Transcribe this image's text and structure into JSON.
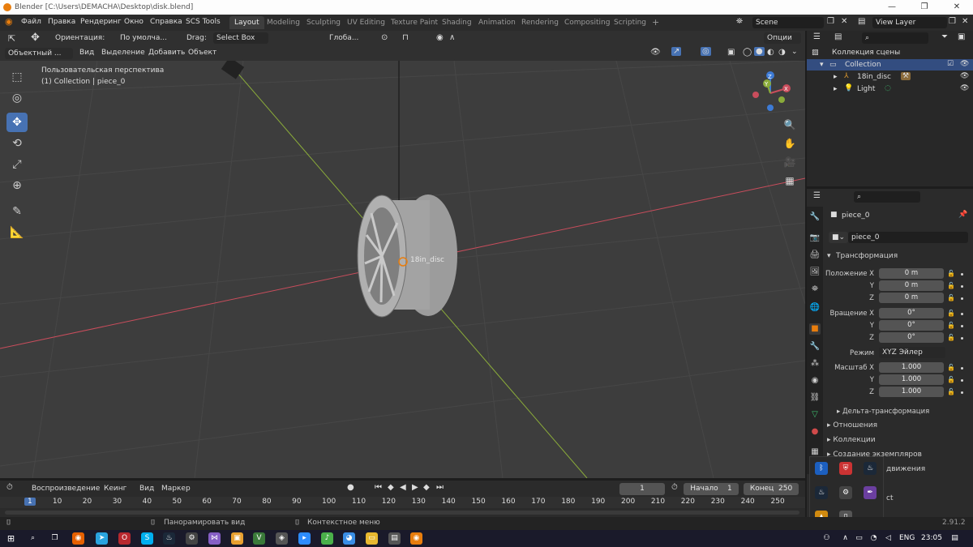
{
  "window": {
    "title": "Blender [C:\\Users\\DEMACHA\\Desktop\\disk.blend]",
    "minimize": "—",
    "maximize": "❐",
    "close": "✕"
  },
  "menu": {
    "items": [
      "Файл",
      "Правка",
      "Рендеринг",
      "Окно",
      "Справка",
      "SCS Tools"
    ]
  },
  "workspaces": {
    "tabs": [
      "Layout",
      "Modeling",
      "Sculpting",
      "UV Editing",
      "Texture Paint",
      "Shading",
      "Animation",
      "Rendering",
      "Compositing",
      "Scripting"
    ],
    "active": "Layout",
    "add": "+"
  },
  "scene": {
    "label": "Scene",
    "view_layer": "View Layer"
  },
  "header": {
    "orientation_label": "Ориентация:",
    "orientation_value": "По умолча...",
    "drag_label": "Drag:",
    "drag_value": "Select Box",
    "global_value": "Глоба...",
    "options": "Опции"
  },
  "viewport_header": {
    "mode": "Объектный ...",
    "view": "Вид",
    "select": "Выделение",
    "add": "Добавить",
    "object": "Объект"
  },
  "viewport": {
    "perspective": "Пользовательская перспектива",
    "collection_info": "(1) Collection | piece_0",
    "object_label": "18in_disc"
  },
  "gizmo": {
    "x": "X",
    "y": "Y",
    "z": "Z"
  },
  "outliner": {
    "root": "Коллекция сцены",
    "collection": "Collection",
    "items": [
      {
        "name": "18in_disc"
      },
      {
        "name": "Light"
      }
    ]
  },
  "properties": {
    "object_name": "piece_0",
    "data_name": "piece_0",
    "transform_title": "Трансформация",
    "location": {
      "label": "Положение X",
      "x": "0 m",
      "y": "0 m",
      "z": "0 m"
    },
    "rotation": {
      "label": "Вращение X",
      "x": "0°",
      "y": "0°",
      "z": "0°"
    },
    "mode_label": "Режим",
    "mode_value": "XYZ Эйлер",
    "scale": {
      "label": "Масштаб X",
      "x": "1.000",
      "y": "1.000",
      "z": "1.000"
    },
    "axis_y": "Y",
    "axis_z": "Z",
    "delta": "Дельта-трансформация",
    "relations": "Отношения",
    "collections": "Коллекции",
    "instancing": "Создание экземпляров",
    "motion_partial": "движения",
    "partial_ct": "ct"
  },
  "timeline": {
    "playback": "Воспроизведение",
    "keying": "Кеинг",
    "view": "Вид",
    "marker": "Маркер",
    "current_frame": "1",
    "start_label": "Начало",
    "start": "1",
    "end_label": "Конец",
    "end": "250",
    "ruler": [
      "1",
      "10",
      "20",
      "30",
      "40",
      "50",
      "60",
      "70",
      "80",
      "90",
      "100",
      "110",
      "120",
      "130",
      "140",
      "150",
      "160",
      "170",
      "180",
      "190",
      "200",
      "210",
      "220",
      "230",
      "240",
      "250"
    ]
  },
  "status": {
    "pan": "Панорамировать вид",
    "context": "Контекстное меню",
    "version": "2.91.2"
  },
  "taskbar": {
    "lang": "ENG",
    "time": "23:05"
  },
  "colors": {
    "accent": "#4772b3",
    "axis_x": "#c94d5c",
    "axis_y": "#8aab3a",
    "axis_z": "#3d7bd6",
    "orange": "#e87d0d"
  }
}
